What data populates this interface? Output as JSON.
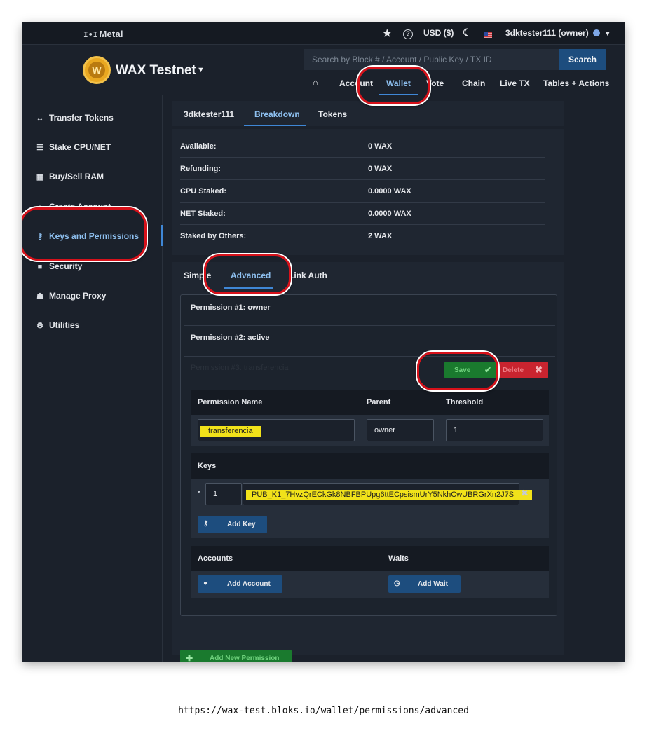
{
  "topbar": {
    "brand": "Metal",
    "brand_icon": "bars-logo-icon",
    "currency": "USD ($)",
    "account": "3dktester111 (owner)"
  },
  "header": {
    "network": "WAX Testnet",
    "search_placeholder": "Search by Block # / Account / Public Key / TX ID",
    "search_button": "Search",
    "nav": [
      "Account",
      "Wallet",
      "Vote",
      "Chain",
      "Live TX",
      "Tables + Actions"
    ]
  },
  "sidebar": {
    "items": [
      {
        "label": "Transfer Tokens",
        "icon": "arrows-icon"
      },
      {
        "label": "Stake CPU/NET",
        "icon": "server-icon"
      },
      {
        "label": "Buy/Sell RAM",
        "icon": "memory-icon"
      },
      {
        "label": "Create Account",
        "icon": "user-icon"
      },
      {
        "label": "Keys and Permissions",
        "icon": "key-icon"
      },
      {
        "label": "Security",
        "icon": "lock-icon"
      },
      {
        "label": "Manage Proxy",
        "icon": "users-icon"
      },
      {
        "label": "Utilities",
        "icon": "gear-icon"
      }
    ]
  },
  "account_tabs": [
    "3dktester111",
    "Breakdown",
    "Tokens"
  ],
  "breakdown": [
    {
      "label": "Available:",
      "value": "0 WAX"
    },
    {
      "label": "Refunding:",
      "value": "0 WAX"
    },
    {
      "label": "CPU Staked:",
      "value": "0.0000 WAX"
    },
    {
      "label": "NET Staked:",
      "value": "0.0000 WAX"
    },
    {
      "label": "Staked by Others:",
      "value": "2 WAX"
    }
  ],
  "perm_tabs": [
    "Simple",
    "Advanced",
    "Link Auth"
  ],
  "permissions": {
    "p1": "Permission #1: owner",
    "p2": "Permission #2: active",
    "p3": "Permission #3: transferencia",
    "save": "Save",
    "delete": "Delete",
    "col_name": "Permission Name",
    "col_parent": "Parent",
    "col_threshold": "Threshold",
    "name_value": "transferencia",
    "parent_value": "owner",
    "threshold_value": "1",
    "keys_title": "Keys",
    "key_weight": "1",
    "key_value": "PUB_K1_7HvzQrECkGk8NBFBPUpg6ttECpsismUrY5NkhCwUBRGrXn2J7S",
    "add_key": "Add Key",
    "accounts_title": "Accounts",
    "waits_title": "Waits",
    "add_account": "Add Account",
    "add_wait": "Add Wait",
    "add_new_permission": "Add New Permission"
  },
  "url": "https://wax-test.bloks.io/wallet/permissions/advanced",
  "colors": {
    "accent": "#3f87d6",
    "highlight": "#f1e21a",
    "ring": "#d7111a",
    "success": "#1a7a2e",
    "danger": "#c9242f"
  }
}
